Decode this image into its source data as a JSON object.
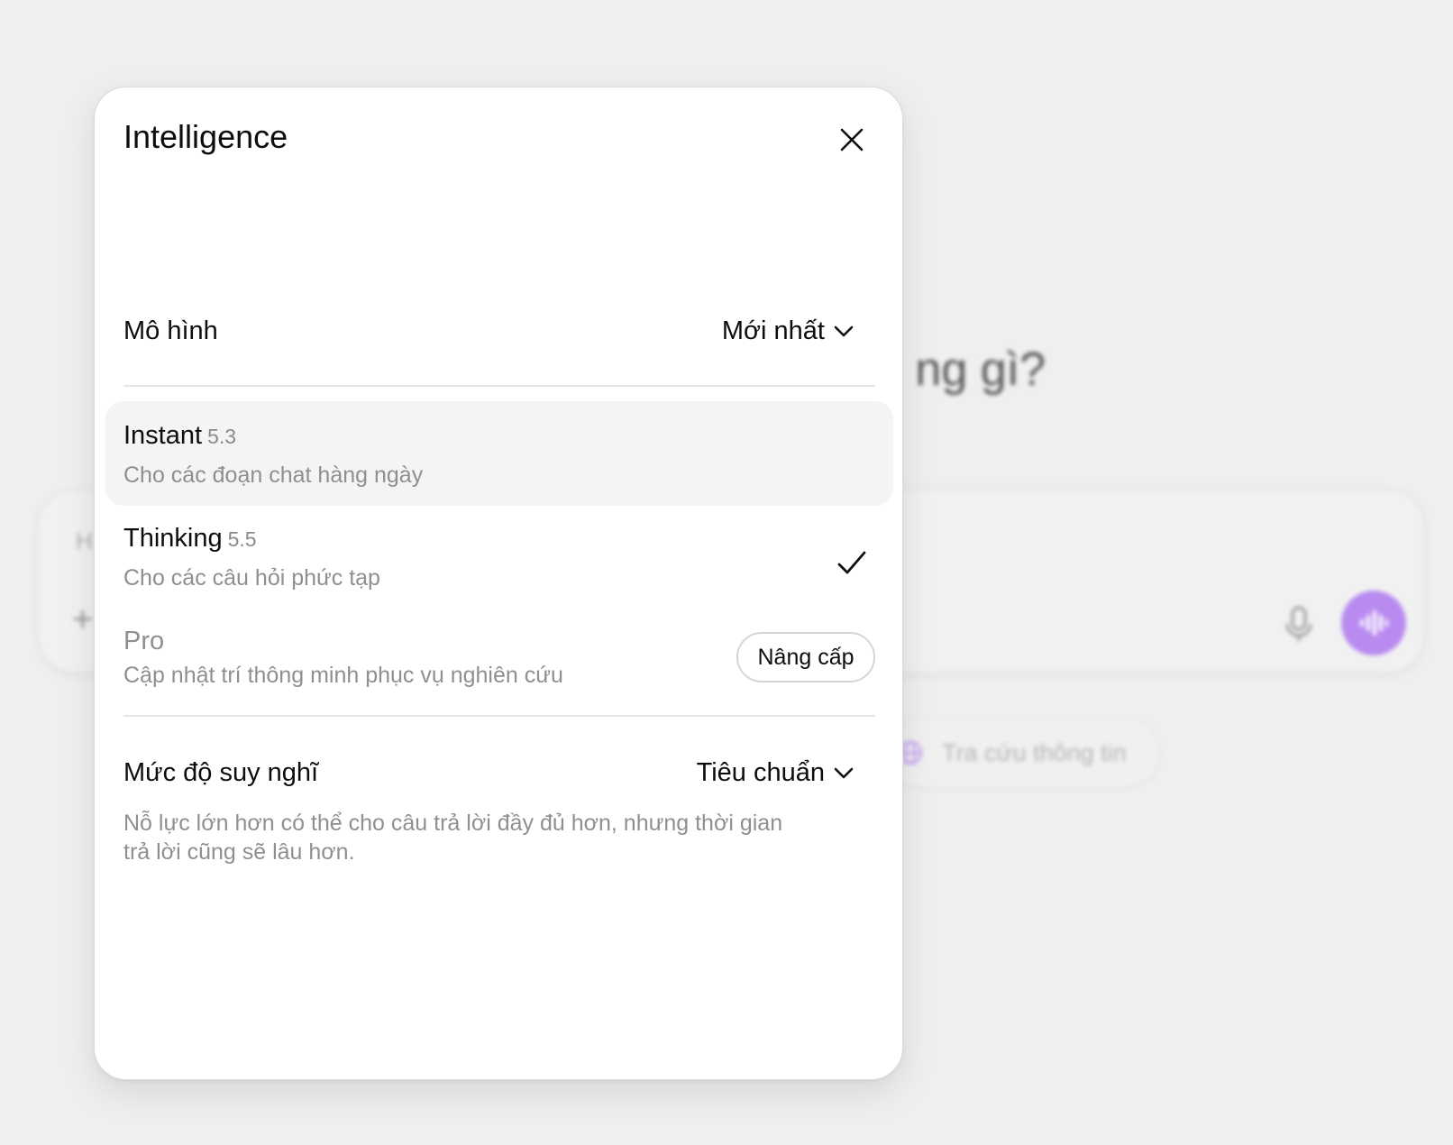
{
  "background": {
    "heading_fragment": "ng gì?",
    "composer_hint": "H",
    "chip_label": "Tra cứu thông tin",
    "voice_button_color": "#b98bf0"
  },
  "modal": {
    "title": "Intelligence",
    "model_row": {
      "label": "Mô hình",
      "selected": "Mới nhất"
    },
    "options": [
      {
        "name": "Instant",
        "version": "5.3",
        "description": "Cho các đoạn chat hàng ngày",
        "highlighted": true,
        "selected": false
      },
      {
        "name": "Thinking",
        "version": "5.5",
        "description": "Cho các câu hỏi phức tạp",
        "highlighted": false,
        "selected": true
      },
      {
        "name": "Pro",
        "description": "Cập nhật trí thông minh phục vụ nghiên cứu",
        "locked": true,
        "action_label": "Nâng cấp"
      }
    ],
    "effort_row": {
      "label": "Mức độ suy nghĩ",
      "selected": "Tiêu chuẩn",
      "description": "Nỗ lực lớn hơn có thể cho câu trả lời đầy đủ hơn, nhưng thời gian trả lời cũng sẽ lâu hơn."
    }
  },
  "icons": {
    "close": "close-icon",
    "chevron": "chevron-down-icon",
    "check": "check-icon",
    "mic": "microphone-icon",
    "voice": "voice-waveform-icon",
    "globe": "globe-icon",
    "plus": "plus-icon"
  }
}
